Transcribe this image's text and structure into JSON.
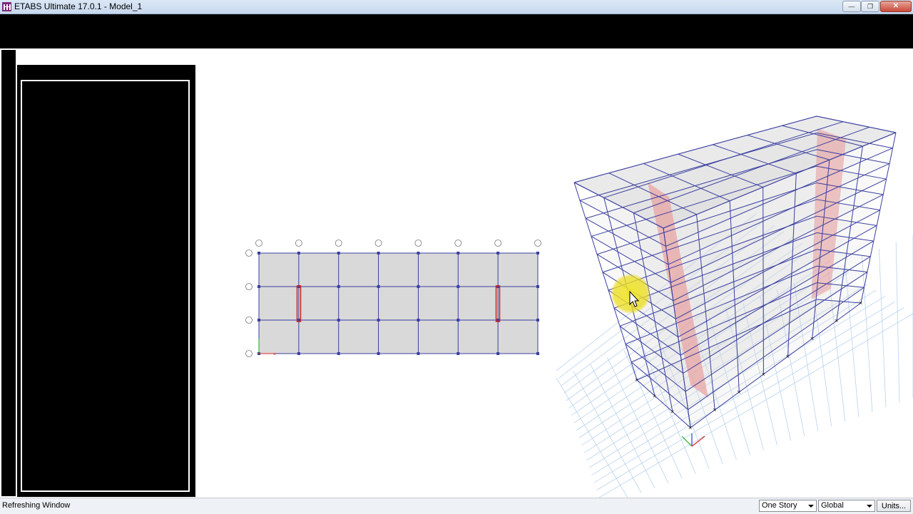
{
  "window": {
    "title": "ETABS Ultimate 17.0.1 - Model_1",
    "min_glyph": "—",
    "max_glyph": "❐",
    "close_glyph": "✕"
  },
  "plan_view": {
    "grid_x_count": 8,
    "grid_y_count": 4,
    "wall_positions": [
      "between first Y grid lines at X grid 2",
      "between first Y grid lines at X grid 7"
    ]
  },
  "statusbar": {
    "status": "Refreshing Window",
    "story_select": "One Story",
    "coord_select": "Global",
    "units_button": "Units..."
  },
  "colors": {
    "frame_line": "#3a3fa0",
    "slab_fill": "#d9d9d9",
    "wall_fill": "#e8a0a0",
    "wall_outline": "#cc2222",
    "ground_grid": "#b8d2ee",
    "cursor_highlight": "#efe028"
  },
  "icons": [
    "app-icon",
    "minimize-icon",
    "maximize-icon",
    "close-icon",
    "dropdown-arrow-icon",
    "mouse-cursor-icon"
  ]
}
